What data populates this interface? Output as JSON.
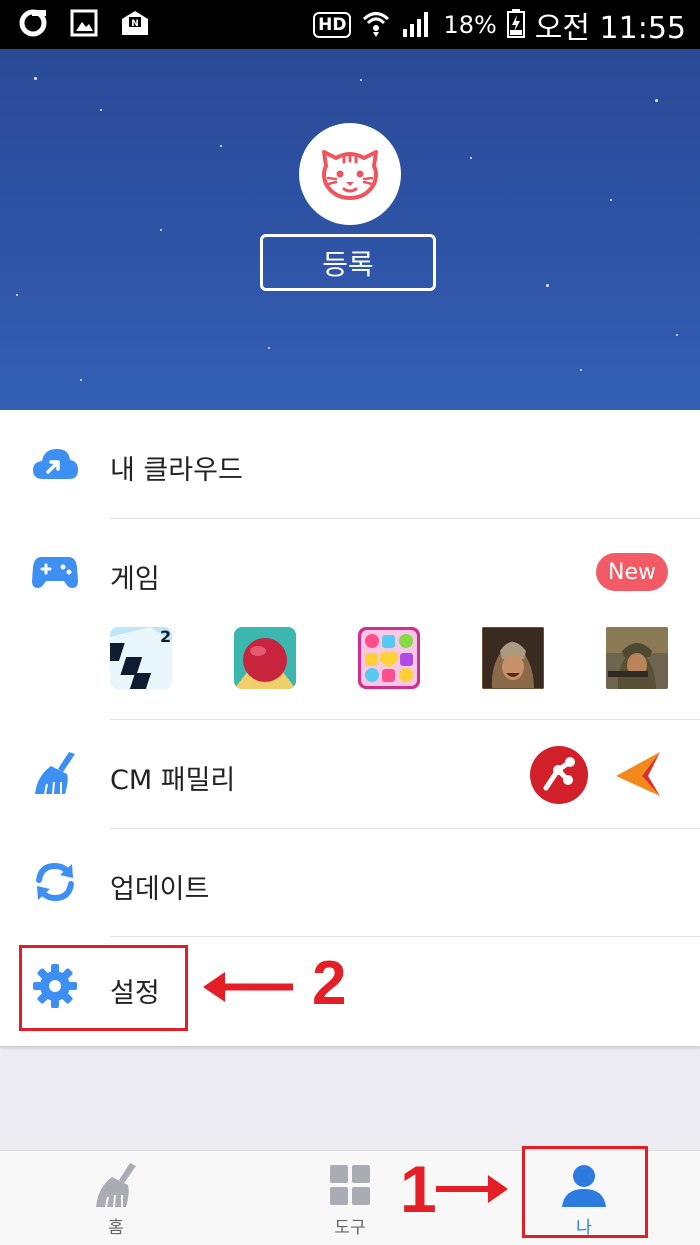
{
  "status_bar": {
    "battery": "18%",
    "time": "오전 11:55",
    "hd_badge": "HD"
  },
  "header": {
    "register_label": "등록"
  },
  "menu": {
    "cloud_label": "내 클라우드",
    "game_label": "게임",
    "new_badge": "New",
    "game_icons": [
      "piano-tiles-2-icon",
      "rolling-ball-icon",
      "candy-puzzle-icon",
      "warrior-game-icon",
      "soldier-game-icon"
    ],
    "family_label": "CM 패밀리",
    "update_label": "업데이트",
    "settings_label": "설정"
  },
  "annotations": {
    "settings_number": "2",
    "me_number": "1",
    "color": "#e41e26"
  },
  "bottom_nav": {
    "home_label": "홈",
    "tools_label": "도구",
    "me_label": "나",
    "active": "나",
    "active_color": "#2e7be0"
  }
}
